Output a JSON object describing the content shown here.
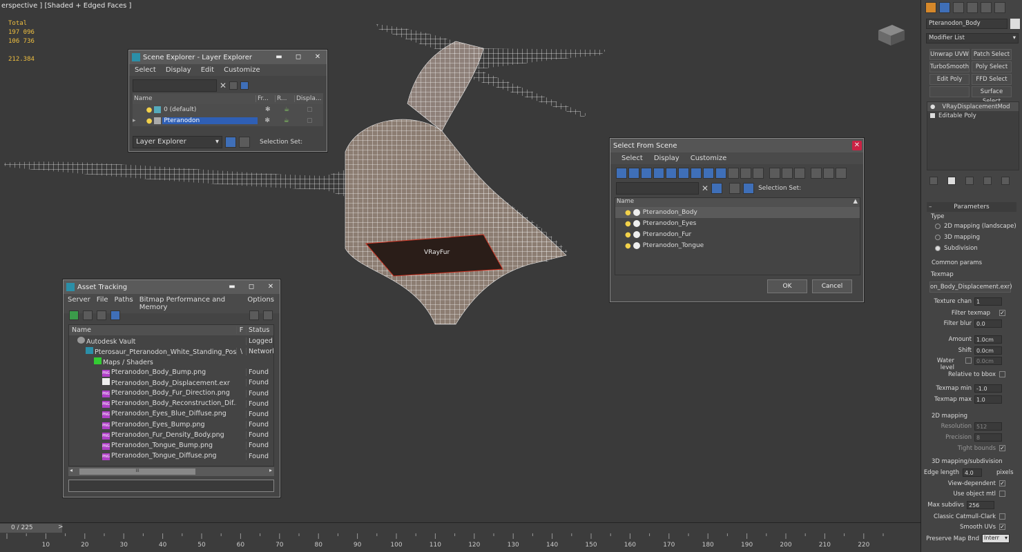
{
  "viewport": {
    "label": "erspective ] [Shaded + Edged Faces ]",
    "stats": {
      "total_label": "Total",
      "polys": "197 096",
      "verts": "106 736",
      "fps": "212.384"
    },
    "model_label": "VRayFur"
  },
  "scene_explorer": {
    "title": "Scene Explorer - Layer Explorer",
    "menu": [
      "Select",
      "Display",
      "Edit",
      "Customize"
    ],
    "columns": [
      "Name",
      "Fr...",
      "R...",
      "Displa..."
    ],
    "rows": [
      {
        "name": "0 (default)",
        "selected": false
      },
      {
        "name": "Pteranodon",
        "selected": true
      }
    ],
    "explorer_select": "Layer Explorer",
    "selection_set_label": "Selection Set:"
  },
  "select_from_scene": {
    "title": "Select From Scene",
    "menu": [
      "Select",
      "Display",
      "Customize"
    ],
    "selection_set_label": "Selection Set:",
    "column": "Name",
    "items": [
      "Pteranodon_Body",
      "Pteranodon_Eyes",
      "Pteranodon_Fur",
      "Pteranodon_Tongue"
    ],
    "ok": "OK",
    "cancel": "Cancel"
  },
  "asset_tracking": {
    "title": "Asset Tracking",
    "menu": [
      "Server",
      "File",
      "Paths",
      "Bitmap Performance and Memory",
      "Options"
    ],
    "columns": [
      "Name",
      "F",
      "Status"
    ],
    "rows": [
      {
        "name": "Autodesk Vault",
        "f": "",
        "status": "Logged",
        "indent": 1,
        "icon": "vault"
      },
      {
        "name": "Pterosaur_Pteranodon_White_Standing_Pos...",
        "f": "\\",
        "status": "Network",
        "indent": 2,
        "icon": "max"
      },
      {
        "name": "Maps / Shaders",
        "f": "",
        "status": "",
        "indent": 3,
        "icon": "maps"
      },
      {
        "name": "Pteranodon_Body_Bump.png",
        "f": "",
        "status": "Found",
        "indent": 4,
        "icon": "png"
      },
      {
        "name": "Pteranodon_Body_Displacement.exr",
        "f": "",
        "status": "Found",
        "indent": 4,
        "icon": "exr"
      },
      {
        "name": "Pteranodon_Body_Fur_Direction.png",
        "f": "",
        "status": "Found",
        "indent": 4,
        "icon": "png"
      },
      {
        "name": "Pteranodon_Body_Reconstruction_Dif...",
        "f": "",
        "status": "Found",
        "indent": 4,
        "icon": "png"
      },
      {
        "name": "Pteranodon_Eyes_Blue_Diffuse.png",
        "f": "",
        "status": "Found",
        "indent": 4,
        "icon": "png"
      },
      {
        "name": "Pteranodon_Eyes_Bump.png",
        "f": "",
        "status": "Found",
        "indent": 4,
        "icon": "png"
      },
      {
        "name": "Pteranodon_Fur_Density_Body.png",
        "f": "",
        "status": "Found",
        "indent": 4,
        "icon": "png"
      },
      {
        "name": "Pteranodon_Tongue_Bump.png",
        "f": "",
        "status": "Found",
        "indent": 4,
        "icon": "png"
      },
      {
        "name": "Pteranodon_Tongue_Diffuse.png",
        "f": "",
        "status": "Found",
        "indent": 4,
        "icon": "png"
      }
    ],
    "scroll_mid": "III"
  },
  "command_panel": {
    "object_name": "Pteranodon_Body",
    "modifier_list": "Modifier List",
    "modifier_buttons": [
      "Unwrap UVW",
      "Patch Select",
      "TurboSmooth",
      "Poly Select",
      "Edit Poly",
      "FFD Select",
      "",
      "Surface Select"
    ],
    "stack": [
      "VRayDisplacementMod",
      "Editable Poly"
    ],
    "parameters_title": "Parameters",
    "type_label": "Type",
    "type_options": [
      "2D mapping (landscape)",
      "3D mapping",
      "Subdivision"
    ],
    "type_selected": 2,
    "common_params": "Common params",
    "texmap_label": "Texmap",
    "texmap_value": "on_Body_Displacement.exr)",
    "texture_chan": {
      "label": "Texture chan",
      "value": "1"
    },
    "filter_texmap": "Filter texmap",
    "filter_blur": {
      "label": "Filter blur",
      "value": "0.0"
    },
    "amount": {
      "label": "Amount",
      "value": "1.0cm"
    },
    "shift": {
      "label": "Shift",
      "value": "0.0cm"
    },
    "water_level": {
      "label": "Water level",
      "value": "0.0cm"
    },
    "relative_bbox": "Relative to bbox",
    "texmap_min": {
      "label": "Texmap min",
      "value": "-1.0"
    },
    "texmap_max": {
      "label": "Texmap max",
      "value": "1.0"
    },
    "mapping_2d": "2D mapping",
    "resolution": {
      "label": "Resolution",
      "value": "512"
    },
    "precision": {
      "label": "Precision",
      "value": "8"
    },
    "tight_bounds": "Tight bounds",
    "mapping_3d": "3D mapping/subdivision",
    "edge_length": {
      "label": "Edge length",
      "value": "4.0",
      "unit": "pixels"
    },
    "view_dependent": "View-dependent",
    "use_object_mtl": "Use object mtl",
    "max_subdivs": {
      "label": "Max subdivs",
      "value": "256"
    },
    "classic_catmull": "Classic Catmull-Clark",
    "smooth_uvs": "Smooth UVs",
    "preserve_map": {
      "label": "Preserve Map Bnd",
      "value": "Interr"
    }
  },
  "timeline": {
    "frame": "0 / 225",
    "next": ">",
    "ticks": [
      "10",
      "20",
      "30",
      "40",
      "50",
      "60",
      "70",
      "80",
      "90",
      "100",
      "110",
      "120",
      "130",
      "140",
      "150",
      "160",
      "170",
      "180",
      "190",
      "200",
      "210",
      "220"
    ]
  },
  "colors": {
    "accent": "#2f5fb5",
    "highlight_blue": "#3f6fb8",
    "stats_yellow": "#f0c040",
    "png_icon": "#b040c8"
  }
}
